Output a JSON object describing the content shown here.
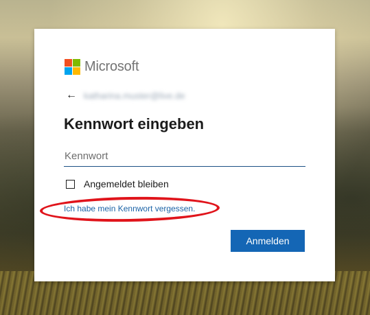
{
  "brand": {
    "name": "Microsoft",
    "logo_colors": [
      "#f25022",
      "#7fba00",
      "#00a4ef",
      "#ffb900"
    ]
  },
  "account": {
    "email": "katharina.muster@live.de",
    "back_icon": "arrow-left-icon"
  },
  "page": {
    "title": "Kennwort eingeben"
  },
  "form": {
    "password": {
      "placeholder": "Kennwort",
      "value": ""
    },
    "stay_signed_in": {
      "label": "Angemeldet bleiben",
      "checked": false
    },
    "forgot_link": "Ich habe mein Kennwort vergessen.",
    "submit_label": "Anmelden"
  },
  "annotation": {
    "type": "red-ellipse",
    "color": "#e0141b",
    "target": "forgot_link"
  },
  "colors": {
    "accent": "#1466b5",
    "link": "#1a62a6",
    "input_underline": "#1a4f83"
  }
}
